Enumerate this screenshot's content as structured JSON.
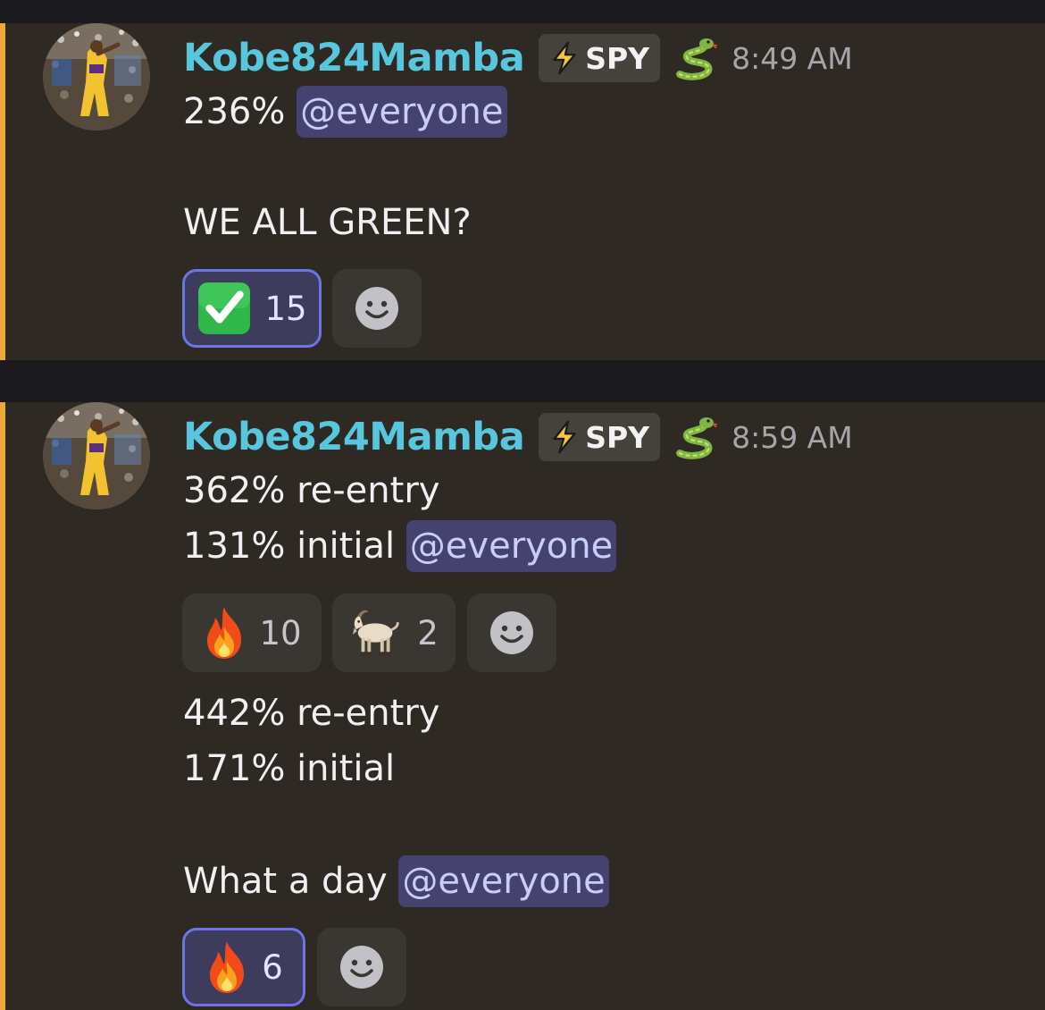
{
  "messages": [
    {
      "username": "Kobe824Mamba",
      "role_tag": "SPY",
      "role_icon": "lightning-icon",
      "badge_icon": "snake-icon",
      "timestamp": "8:49 AM",
      "lines": [
        {
          "text": "236% ",
          "mention": "@everyone"
        },
        {
          "text": "WE ALL GREEN?"
        }
      ],
      "reactions": [
        {
          "emoji": "check-mark-button",
          "count": "15",
          "active": true
        }
      ]
    },
    {
      "username": "Kobe824Mamba",
      "role_tag": "SPY",
      "role_icon": "lightning-icon",
      "badge_icon": "snake-icon",
      "timestamp": "8:59 AM",
      "lines": [
        {
          "text": "362% re-entry"
        },
        {
          "text": "131% initial ",
          "mention": "@everyone"
        }
      ],
      "reactions": [
        {
          "emoji": "fire",
          "count": "10",
          "active": false
        },
        {
          "emoji": "goat",
          "count": "2",
          "active": false
        }
      ],
      "followup_lines": [
        {
          "text": "442% re-entry"
        },
        {
          "text": "171% initial"
        },
        {
          "text": "What a day ",
          "mention": "@everyone"
        }
      ],
      "followup_reactions": [
        {
          "emoji": "fire",
          "count": "6",
          "active": true
        }
      ]
    }
  ],
  "colors": {
    "username": "#58c6dd",
    "accent_bar": "#eda83a",
    "mention_bg": "#45426f",
    "mention_text": "#c9cdfb",
    "active_reaction_border": "#6d74e6"
  }
}
